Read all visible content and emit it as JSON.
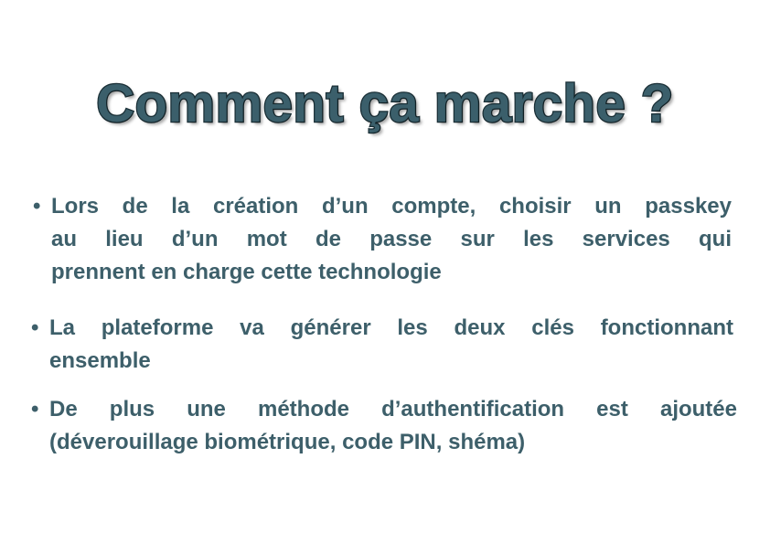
{
  "title": "Comment ça marche ?",
  "bullet_symbol": "•",
  "bullets": [
    {
      "lines": [
        "Lors de la création d’un compte, choisir un passkey",
        "au lieu d’un mot de passe sur les services qui",
        "prennent en charge cette technologie"
      ]
    },
    {
      "lines": [
        "La plateforme va générer les deux clés fonctionnant",
        "ensemble"
      ]
    },
    {
      "lines": [
        "De plus une méthode d’authentification est ajoutée",
        "(déverouillage biométrique, code PIN, shéma)"
      ]
    }
  ],
  "colors": {
    "title_fill": "#3b5f6b",
    "title_stroke": "#1a2f36",
    "text": "#3d5f6a",
    "background": "#ffffff"
  }
}
